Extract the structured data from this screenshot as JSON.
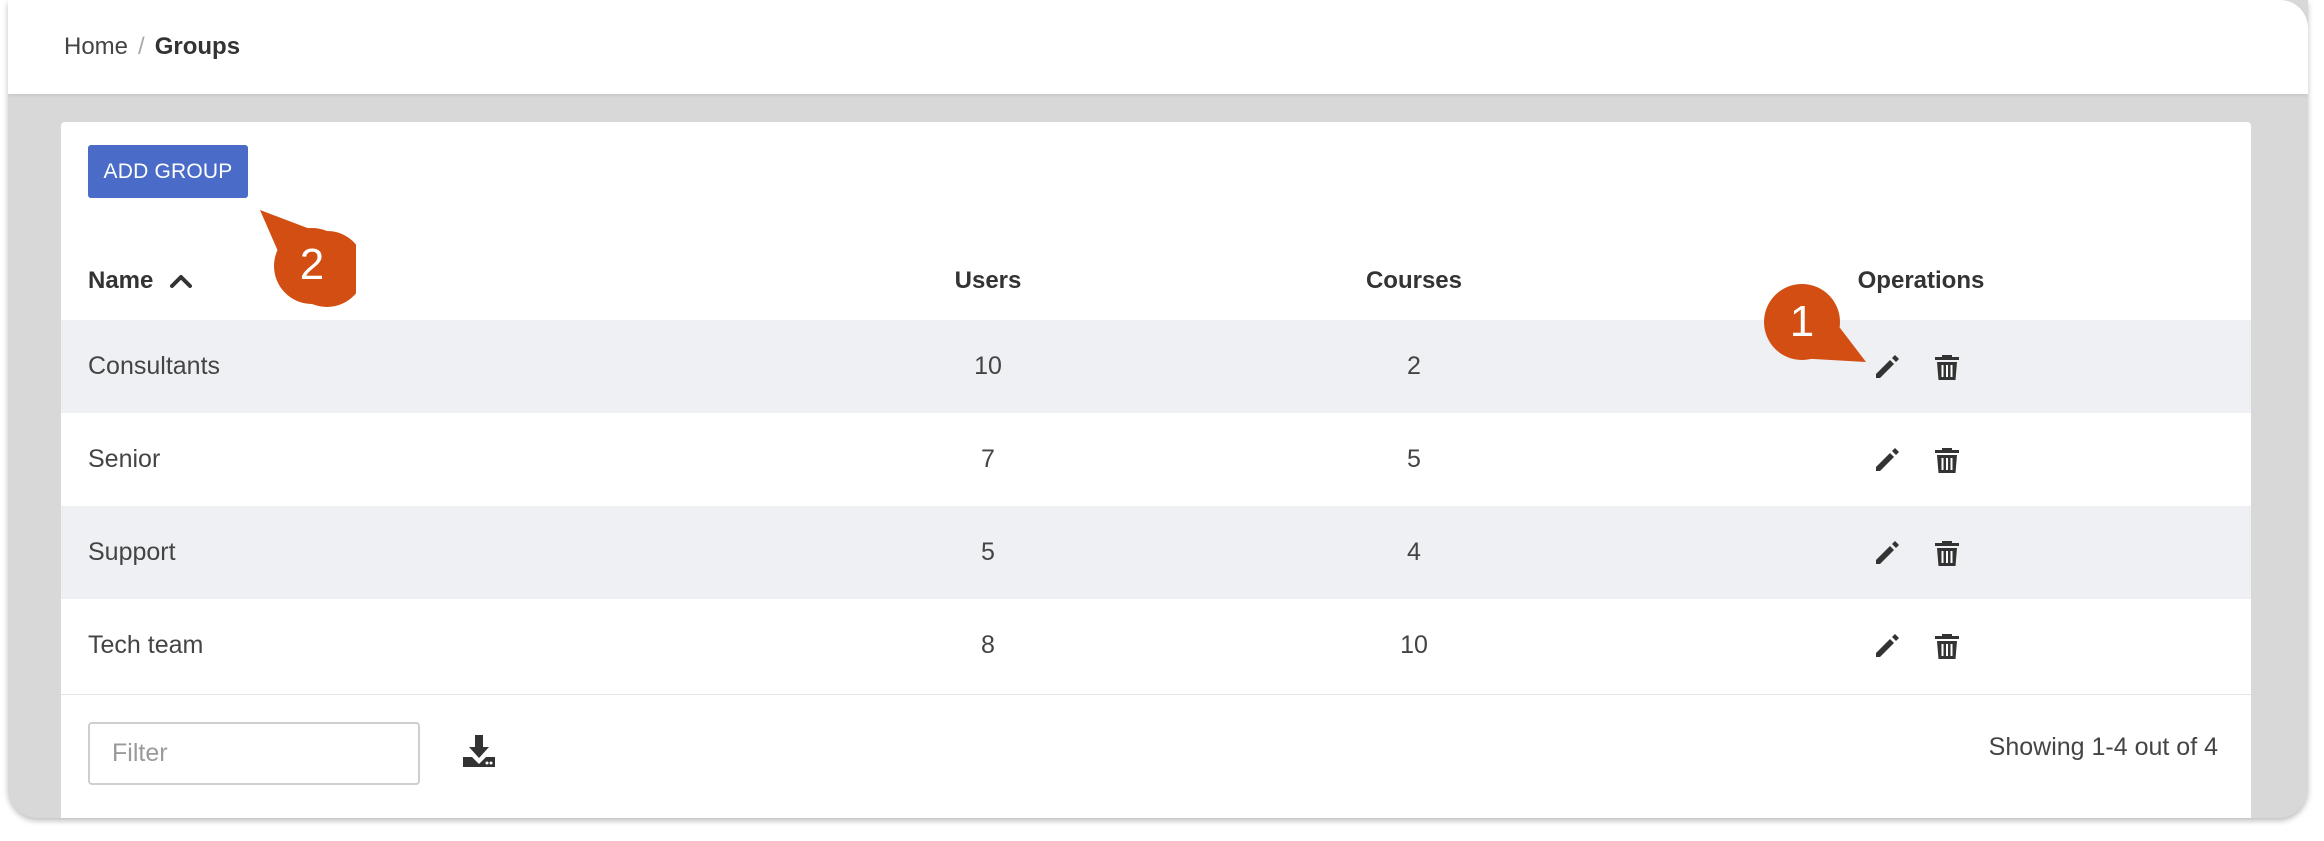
{
  "breadcrumb": {
    "home": "Home",
    "separator": "/",
    "current": "Groups"
  },
  "toolbar": {
    "add_label": "ADD GROUP"
  },
  "table": {
    "headers": {
      "name": "Name",
      "users": "Users",
      "courses": "Courses",
      "operations": "Operations"
    },
    "sort": {
      "column": "Name",
      "direction": "ascending",
      "icon": "chevron-up-icon"
    },
    "rows": [
      {
        "name": "Consultants",
        "users": "10",
        "courses": "2"
      },
      {
        "name": "Senior",
        "users": "7",
        "courses": "5"
      },
      {
        "name": "Support",
        "users": "5",
        "courses": "4"
      },
      {
        "name": "Tech team",
        "users": "8",
        "courses": "10"
      }
    ],
    "row_icons": [
      "pencil-icon",
      "trash-icon"
    ]
  },
  "footer": {
    "filter_placeholder": "Filter",
    "download_icon": "download-icon",
    "showing": "Showing 1-4 out of 4"
  },
  "callouts": [
    {
      "label": "1",
      "target": "edit icon of first row"
    },
    {
      "label": "2",
      "target": "ADD GROUP button"
    }
  ],
  "colors": {
    "accent": "#4a6cc8",
    "callout": "#d24e12",
    "row_stripe": "#eff0f4",
    "background": "#d8d8d8"
  }
}
